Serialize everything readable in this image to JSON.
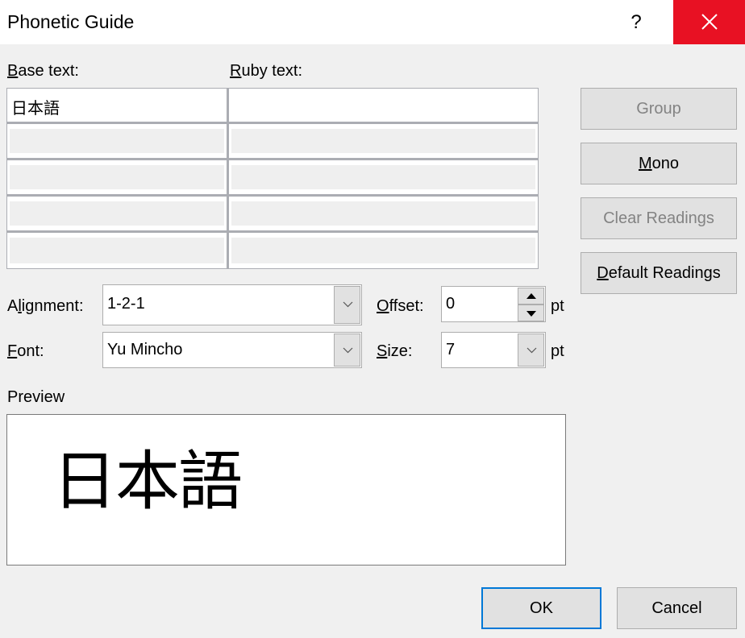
{
  "window": {
    "title": "Phonetic Guide",
    "help_label": "?",
    "close_color": "#e81123"
  },
  "labels": {
    "base_text": {
      "accel": "B",
      "rest": "ase text:"
    },
    "ruby_text": {
      "accel": "R",
      "rest": "uby text:"
    },
    "alignment": {
      "pre": "A",
      "accel": "l",
      "rest": "ignment:"
    },
    "font": {
      "accel": "F",
      "rest": "ont:"
    },
    "offset": {
      "accel": "O",
      "rest": "ffset:"
    },
    "size": {
      "accel": "S",
      "rest": "ize:"
    },
    "offset_unit": "pt",
    "size_unit": "pt",
    "preview": "Preview"
  },
  "grid": {
    "rows": [
      {
        "base": "日本語",
        "ruby": ""
      },
      {
        "base": "",
        "ruby": ""
      },
      {
        "base": "",
        "ruby": ""
      },
      {
        "base": "",
        "ruby": ""
      },
      {
        "base": "",
        "ruby": ""
      }
    ]
  },
  "buttons": {
    "group": "Group",
    "mono": {
      "accel": "M",
      "rest": "ono"
    },
    "clear_readings": "Clear Readings",
    "default_readings": {
      "accel": "D",
      "rest": "efault Readings"
    },
    "ok": "OK",
    "cancel": "Cancel"
  },
  "fields": {
    "alignment": "1-2-1",
    "font": "Yu Mincho",
    "offset": "0",
    "size": "7"
  },
  "preview": {
    "text": "日本語"
  },
  "colors": {
    "default_button_border": "#0078d7",
    "disabled_text": "#838383"
  }
}
